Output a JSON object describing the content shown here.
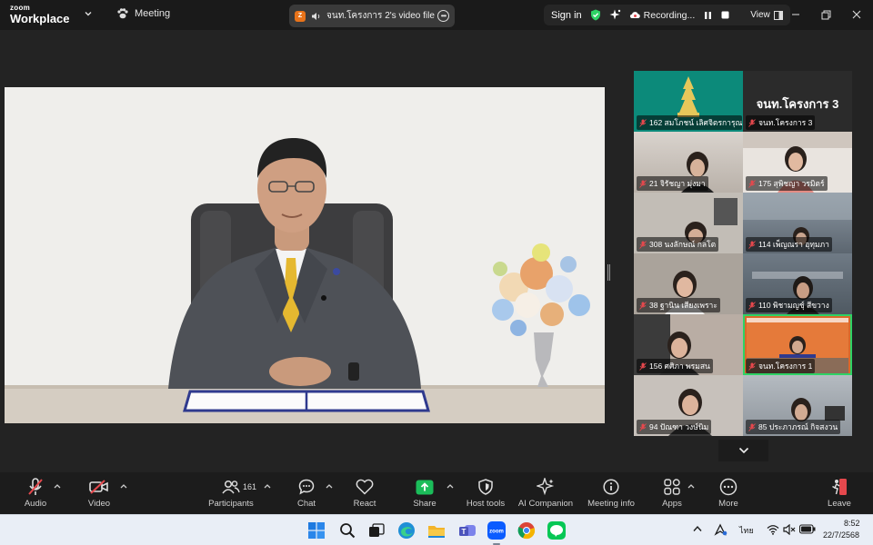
{
  "app": {
    "brand_small": "zoom",
    "brand_large": "Workplace"
  },
  "topbar": {
    "meeting_label": "Meeting",
    "video_tab_label": "จนท.โครงการ 2's video file",
    "signin_label": "Sign in",
    "recording_label": "Recording...",
    "view_label": "View"
  },
  "gallery": {
    "tiles": [
      {
        "name": "162 สมโภชน์ เลิศจิตรการุณ",
        "tone": "#0c8a7a"
      },
      {
        "name": "จนท.โครงการ 3",
        "big_label": "จนท.โครงการ 3",
        "tone": "#2b2b2b"
      },
      {
        "name": "21 จิรัชญา มุ่งมา",
        "tone": "#c9c3bd"
      },
      {
        "name": "175 สุพิชญา วรมิตร์",
        "tone": "#d8cfc8"
      },
      {
        "name": "308 นงลักษณ์ กลโต",
        "tone": "#b8b4ae"
      },
      {
        "name": "114 เพ็ญณรา อุทุมภา",
        "tone": "#6e7d8a"
      },
      {
        "name": "38 ฐานิน เสียงเพราะ",
        "tone": "#a9a29b"
      },
      {
        "name": "110 พิชามญชุ์ สีขวาง",
        "tone": "#5e6a76"
      },
      {
        "name": "156 ศศิภา พรมสน",
        "tone": "#b9ada4"
      },
      {
        "name": "จนท.โครงการ 1",
        "tone": "#d9692a"
      },
      {
        "name": "94 ปัณฑา วงษ์นิม",
        "tone": "#c7c1bb"
      },
      {
        "name": "85 ประภาภรณ์ กิจสงวน",
        "tone": "#9fa6ad"
      }
    ]
  },
  "toolbar": {
    "audio": "Audio",
    "video": "Video",
    "participants": "Participants",
    "participants_count": "161",
    "chat": "Chat",
    "react": "React",
    "share": "Share",
    "host_tools": "Host tools",
    "ai_companion": "AI Companion",
    "meeting_info": "Meeting info",
    "apps": "Apps",
    "more": "More",
    "leave": "Leave"
  },
  "taskbar": {
    "language": "ไทย",
    "time": "8:52",
    "date": "22/7/2568"
  },
  "colors": {
    "accent_green": "#2ed365",
    "share_green": "#1bbd5a",
    "muted_red": "#e5484d",
    "leave_red": "#e5484d"
  }
}
